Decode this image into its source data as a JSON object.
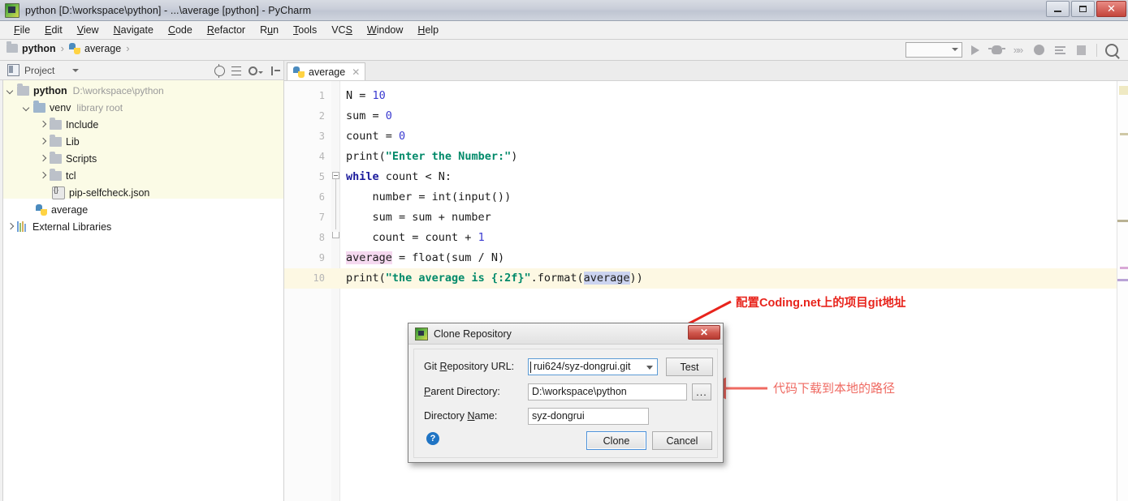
{
  "window": {
    "title": "python [D:\\workspace\\python] - ...\\average [python] - PyCharm",
    "minimize_label": "",
    "maximize_label": "",
    "close_label": "✕"
  },
  "menu": [
    {
      "label": "File"
    },
    {
      "label": "Edit"
    },
    {
      "label": "View"
    },
    {
      "label": "Navigate"
    },
    {
      "label": "Code"
    },
    {
      "label": "Refactor"
    },
    {
      "label": "Run"
    },
    {
      "label": "Tools"
    },
    {
      "label": "VCS"
    },
    {
      "label": "Window"
    },
    {
      "label": "Help"
    }
  ],
  "breadcrumb": {
    "project": "python",
    "file": "average",
    "separator": "›"
  },
  "toolbar": {
    "run_config_value": "",
    "icons": [
      "run-icon",
      "debug-icon",
      "run-with-coverage-icon",
      "profile-icon",
      "attach-icon",
      "stop-icon",
      "search-icon"
    ]
  },
  "project_panel": {
    "title": "Project",
    "buttons": [
      "locate-icon",
      "collapse-all-icon",
      "settings-gear-icon",
      "hide-icon"
    ],
    "tree": [
      {
        "label": "python",
        "detail": "D:\\workspace\\python",
        "icon": "folder-icon",
        "expanded": true,
        "depth": 0,
        "bold": true
      },
      {
        "label": "venv",
        "detail": "library root",
        "icon": "folder-icon",
        "expanded": true,
        "depth": 1,
        "bold": false
      },
      {
        "label": "Include",
        "detail": "",
        "icon": "folder-icon",
        "expanded": false,
        "depth": 2,
        "bold": false
      },
      {
        "label": "Lib",
        "detail": "",
        "icon": "folder-icon",
        "expanded": false,
        "depth": 2,
        "bold": false
      },
      {
        "label": "Scripts",
        "detail": "",
        "icon": "folder-icon",
        "expanded": false,
        "depth": 2,
        "bold": false
      },
      {
        "label": "tcl",
        "detail": "",
        "icon": "folder-icon",
        "expanded": false,
        "depth": 2,
        "bold": false
      },
      {
        "label": "pip-selfcheck.json",
        "detail": "",
        "icon": "json-file-icon",
        "expanded": null,
        "depth": 2,
        "bold": false
      },
      {
        "label": "average",
        "detail": "",
        "icon": "python-file-icon",
        "expanded": null,
        "depth": 1,
        "bold": false
      },
      {
        "label": "External Libraries",
        "detail": "",
        "icon": "library-icon",
        "expanded": false,
        "depth": 0,
        "bold": false
      }
    ]
  },
  "editor": {
    "tab": {
      "label": "average",
      "close": "✕",
      "icon": "python-file-icon"
    },
    "current_line": 10,
    "lines": [
      {
        "n": "1",
        "text": "N = 10"
      },
      {
        "n": "2",
        "text": "sum = 0"
      },
      {
        "n": "3",
        "text": "count = 0"
      },
      {
        "n": "4",
        "text": "print(\"Enter the Number:\")"
      },
      {
        "n": "5",
        "text": "while count < N:"
      },
      {
        "n": "6",
        "text": "    number = int(input())"
      },
      {
        "n": "7",
        "text": "    sum = sum + number"
      },
      {
        "n": "8",
        "text": "    count = count + 1"
      },
      {
        "n": "9",
        "text": "average = float(sum / N)"
      },
      {
        "n": "10",
        "text": "print(\"the average is {:2f}\".format(average))"
      }
    ]
  },
  "dialog": {
    "title": "Clone Repository",
    "close_label": "✕",
    "fields": [
      {
        "label": "Git Repository URL:",
        "mnemonic": "R",
        "value": "rui624/syz-dongrui.git",
        "type": "combobox",
        "focused": true
      },
      {
        "label": "Parent Directory:",
        "mnemonic": "P",
        "value": "D:\\workspace\\python",
        "type": "text",
        "focused": false
      },
      {
        "label": "Directory Name:",
        "mnemonic": "N",
        "value": "syz-dongrui",
        "type": "text",
        "focused": false
      }
    ],
    "test_button": "Test",
    "browse_button": "...",
    "help_button": "?",
    "clone_button": "Clone",
    "cancel_button": "Cancel"
  },
  "annotations": [
    {
      "text": "配置Coding.net上的项目git地址",
      "color": "#e8241c"
    },
    {
      "text": "代码下载到本地的路径",
      "color": "#ef6a62"
    }
  ]
}
